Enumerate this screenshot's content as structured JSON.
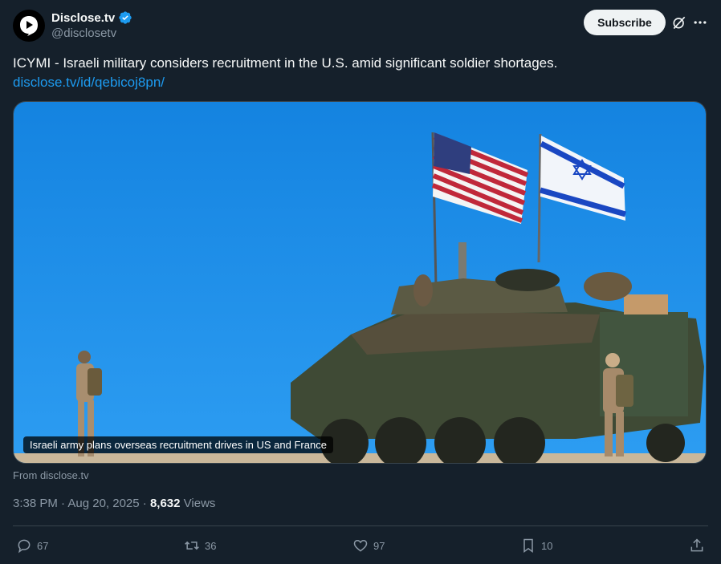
{
  "author": {
    "display_name": "Disclose.tv",
    "handle": "@disclosetv",
    "verified": true
  },
  "header": {
    "subscribe_label": "Subscribe"
  },
  "tweet": {
    "text": "ICYMI - Israeli military considers recruitment in the U.S. amid significant soldier shortages.",
    "link": "disclose.tv/id/qebicoj8pn/"
  },
  "media": {
    "caption": "Israeli army plans overseas recruitment drives in US and France",
    "source": "From disclose.tv"
  },
  "meta": {
    "timestamp": "3:38 PM · Aug 20, 2025 · ",
    "views_count": "8,632",
    "views_label": "Views"
  },
  "actions": {
    "replies": "67",
    "reposts": "36",
    "likes": "97",
    "bookmarks": "10"
  },
  "colors": {
    "background": "#15202b",
    "accent": "#1d9bf0",
    "verified": "#1d9bf0"
  }
}
